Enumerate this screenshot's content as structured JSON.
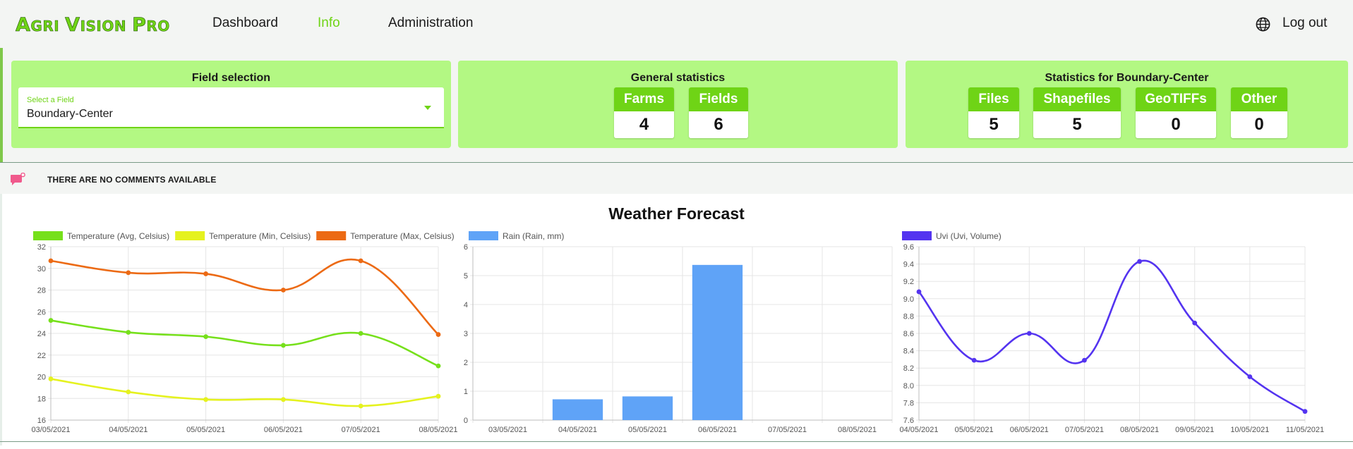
{
  "header": {
    "logo_parts": [
      {
        "text": "A",
        "size": "big"
      },
      {
        "text": "GRI",
        "size": "small"
      },
      {
        "text": "V",
        "size": "big"
      },
      {
        "text": "ISION",
        "size": "small"
      },
      {
        "text": "P",
        "size": "big"
      },
      {
        "text": "RO",
        "size": "small"
      }
    ],
    "nav": [
      {
        "label": "Dashboard",
        "active": false
      },
      {
        "label": "Info",
        "active": true
      },
      {
        "label": "Administration",
        "active": false
      }
    ],
    "globe_icon": "globe-icon",
    "logout_label": "Log out"
  },
  "field_selection": {
    "title": "Field selection",
    "select_label": "Select a Field",
    "select_value": "Boundary-Center",
    "caret_icon": "caret-down-icon"
  },
  "general_statistics": {
    "title": "General statistics",
    "stats": [
      {
        "label": "Farms",
        "value": "4"
      },
      {
        "label": "Fields",
        "value": "6"
      }
    ]
  },
  "field_statistics": {
    "title": "Statistics for Boundary-Center",
    "stats": [
      {
        "label": "Files",
        "value": "5"
      },
      {
        "label": "Shapefiles",
        "value": "5"
      },
      {
        "label": "GeoTIFFs",
        "value": "0"
      },
      {
        "label": "Other",
        "value": "0"
      }
    ]
  },
  "comments": {
    "icon": "comment-icon",
    "text": "THERE ARE NO COMMENTS AVAILABLE"
  },
  "weather": {
    "title": "Weather Forecast"
  },
  "colors": {
    "brand_green": "#6fd416",
    "card_bg": "#b3f883",
    "temp_avg": "#76e01b",
    "temp_min": "#e5f21f",
    "temp_max": "#ec6a14",
    "rain": "#5fa3f7",
    "uvi": "#5434f0",
    "comment_icon": "#f05a8c"
  },
  "chart_data": [
    {
      "type": "line",
      "categories": [
        "03/05/2021",
        "04/05/2021",
        "05/05/2021",
        "06/05/2021",
        "07/05/2021",
        "08/05/2021"
      ],
      "ylim": [
        16,
        32
      ],
      "yticks": [
        "16",
        "18",
        "20",
        "22",
        "24",
        "26",
        "28",
        "30",
        "32"
      ],
      "grid": true,
      "legend_position": "top",
      "series": [
        {
          "name": "Temperature (Avg, Celsius)",
          "color": "#76e01b",
          "values": [
            25.2,
            24.1,
            23.7,
            22.9,
            24.0,
            21.0
          ]
        },
        {
          "name": "Temperature (Min, Celsius)",
          "color": "#e5f21f",
          "values": [
            19.8,
            18.6,
            17.9,
            17.9,
            17.3,
            18.2
          ]
        },
        {
          "name": "Temperature (Max, Celsius)",
          "color": "#ec6a14",
          "values": [
            30.7,
            29.6,
            29.5,
            28.0,
            30.7,
            23.9
          ]
        }
      ]
    },
    {
      "type": "bar",
      "categories": [
        "03/05/2021",
        "04/05/2021",
        "05/05/2021",
        "06/05/2021",
        "07/05/2021",
        "08/05/2021"
      ],
      "ylim": [
        0,
        6
      ],
      "yticks": [
        "0",
        "1",
        "2",
        "3",
        "4",
        "5",
        "6"
      ],
      "grid": true,
      "legend_position": "top",
      "series": [
        {
          "name": "Rain (Rain, mm)",
          "color": "#5fa3f7",
          "values": [
            0,
            0.72,
            0.82,
            5.37,
            0,
            0
          ]
        }
      ]
    },
    {
      "type": "line",
      "categories": [
        "04/05/2021",
        "05/05/2021",
        "06/05/2021",
        "07/05/2021",
        "08/05/2021",
        "09/05/2021",
        "10/05/2021",
        "11/05/2021"
      ],
      "ylim": [
        7.6,
        9.6
      ],
      "yticks": [
        "7.6",
        "7.8",
        "8.0",
        "8.2",
        "8.4",
        "8.6",
        "8.8",
        "9.0",
        "9.2",
        "9.4",
        "9.6"
      ],
      "grid": true,
      "legend_position": "top",
      "series": [
        {
          "name": "Uvi (Uvi, Volume)",
          "color": "#5434f0",
          "values": [
            9.08,
            8.29,
            8.6,
            8.29,
            9.43,
            8.72,
            8.1,
            7.7
          ]
        }
      ]
    }
  ]
}
